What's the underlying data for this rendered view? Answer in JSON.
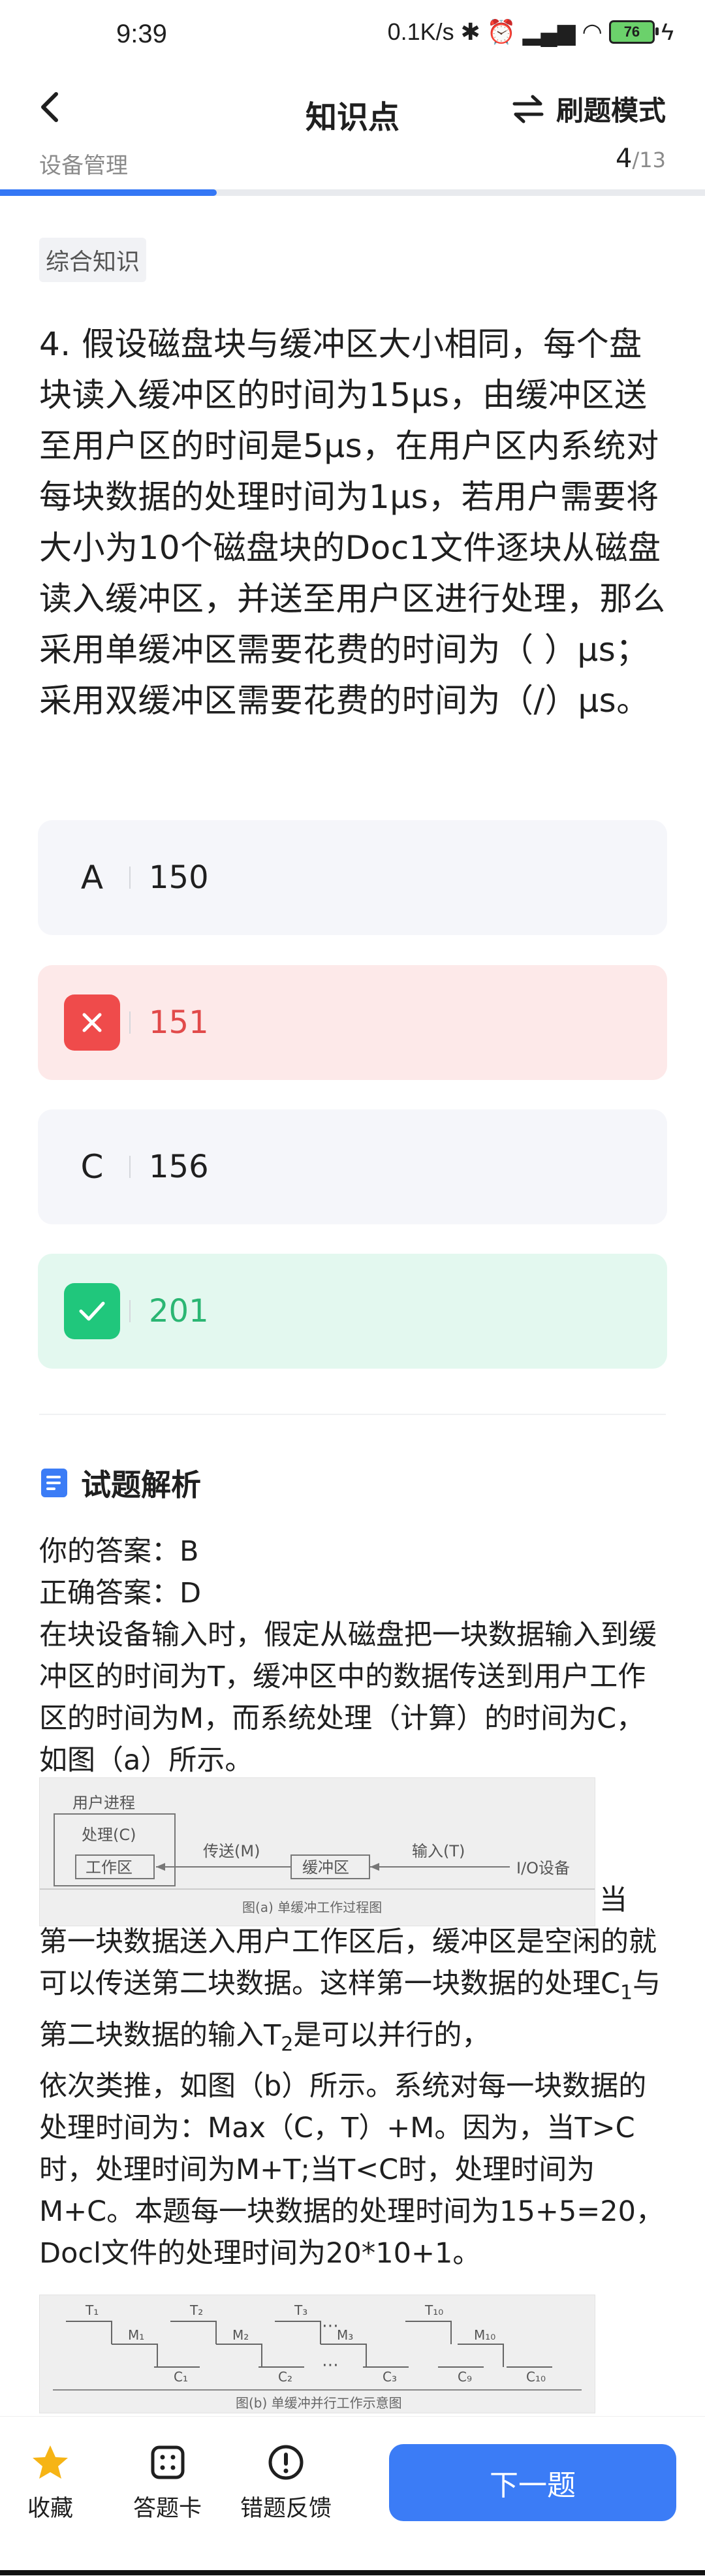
{
  "status_bar": {
    "time": "9:39",
    "network": "0.1K/s",
    "battery": "76"
  },
  "nav": {
    "title": "知识点",
    "mode_label": "刷题模式"
  },
  "breadcrumb": "设备管理",
  "progress": {
    "current": "4",
    "total": "/13",
    "fraction": 0.3077
  },
  "tag": "综合知识",
  "question": {
    "text": "4. 假设磁盘块与缓冲区大小相同，每个盘块读入缓冲区的时间为15μs，由缓冲区送至用户区的时间是5μs，在用户区内系统对每块数据的处理时间为1μs，若用户需要将大小为10个磁盘块的Doc1文件逐块从磁盘读入缓冲区，并送至用户区进行处理，那么采用单缓冲区需要花费的时间为（ ）μs；采用双缓冲区需要花费的时间为（/）μs。"
  },
  "options": [
    {
      "key": "A",
      "value": "150",
      "state": "normal"
    },
    {
      "key": "B",
      "value": "151",
      "state": "wrong"
    },
    {
      "key": "C",
      "value": "156",
      "state": "normal"
    },
    {
      "key": "D",
      "value": "201",
      "state": "correct"
    }
  ],
  "analysis": {
    "title": "试题解析",
    "your_answer": "你的答案：B",
    "correct_answer": "正确答案：D",
    "para1": "在块设备输入时，假定从磁盘把一块数据输入到缓冲区的时间为T，缓冲区中的数据传送到用户工作区的时间为M，而系统处理（计算）的时间为C，如图（a）所示。",
    "fig_a": {
      "process_label": "用户进程",
      "handle_label": "处理(C)",
      "workarea_label": "工作区",
      "send_label": "传送(M)",
      "buffer_label": "缓冲区",
      "input_label": "输入(T)",
      "device_label": "I/O设备",
      "caption": "图(a) 单缓冲工作过程图"
    },
    "para2_lead": "当",
    "para2_a": "第一块数据送入用户工作区后，缓冲区是空闲的就可以传送第二块数据。这样第一块数据的处理C",
    "para2_sub1": "1",
    "para2_b": "与第二块数据的输入T",
    "para2_sub2": "2",
    "para2_c": "是可以并行的，",
    "para3": "依次类推，如图（b）所示。系统对每一块数据的处理时间为：Max（C，T）+M。因为，当T>C时，处理时间为M+T;当T<C时，处理时间为M+C。本题每一块数据的处理时间为15+5=20，Docl文件的处理时间为20*10+1。",
    "fig_b": {
      "t_labels": [
        "T₁",
        "T₂",
        "T₃",
        "T₁₀"
      ],
      "m_labels": [
        "M₁",
        "M₂",
        "M₃",
        "M₁₀"
      ],
      "c_labels": [
        "C₁",
        "C₂",
        "C₃",
        "C₉",
        "C₁₀"
      ],
      "caption": "图(b) 单缓冲并行工作示意图"
    }
  },
  "bottom": {
    "favorite": "收藏",
    "answer_card": "答题卡",
    "feedback": "错题反馈",
    "next": "下一题"
  },
  "colors": {
    "accent": "#3b7cf6",
    "wrong": "#ef4b4b",
    "correct": "#20c77c"
  }
}
